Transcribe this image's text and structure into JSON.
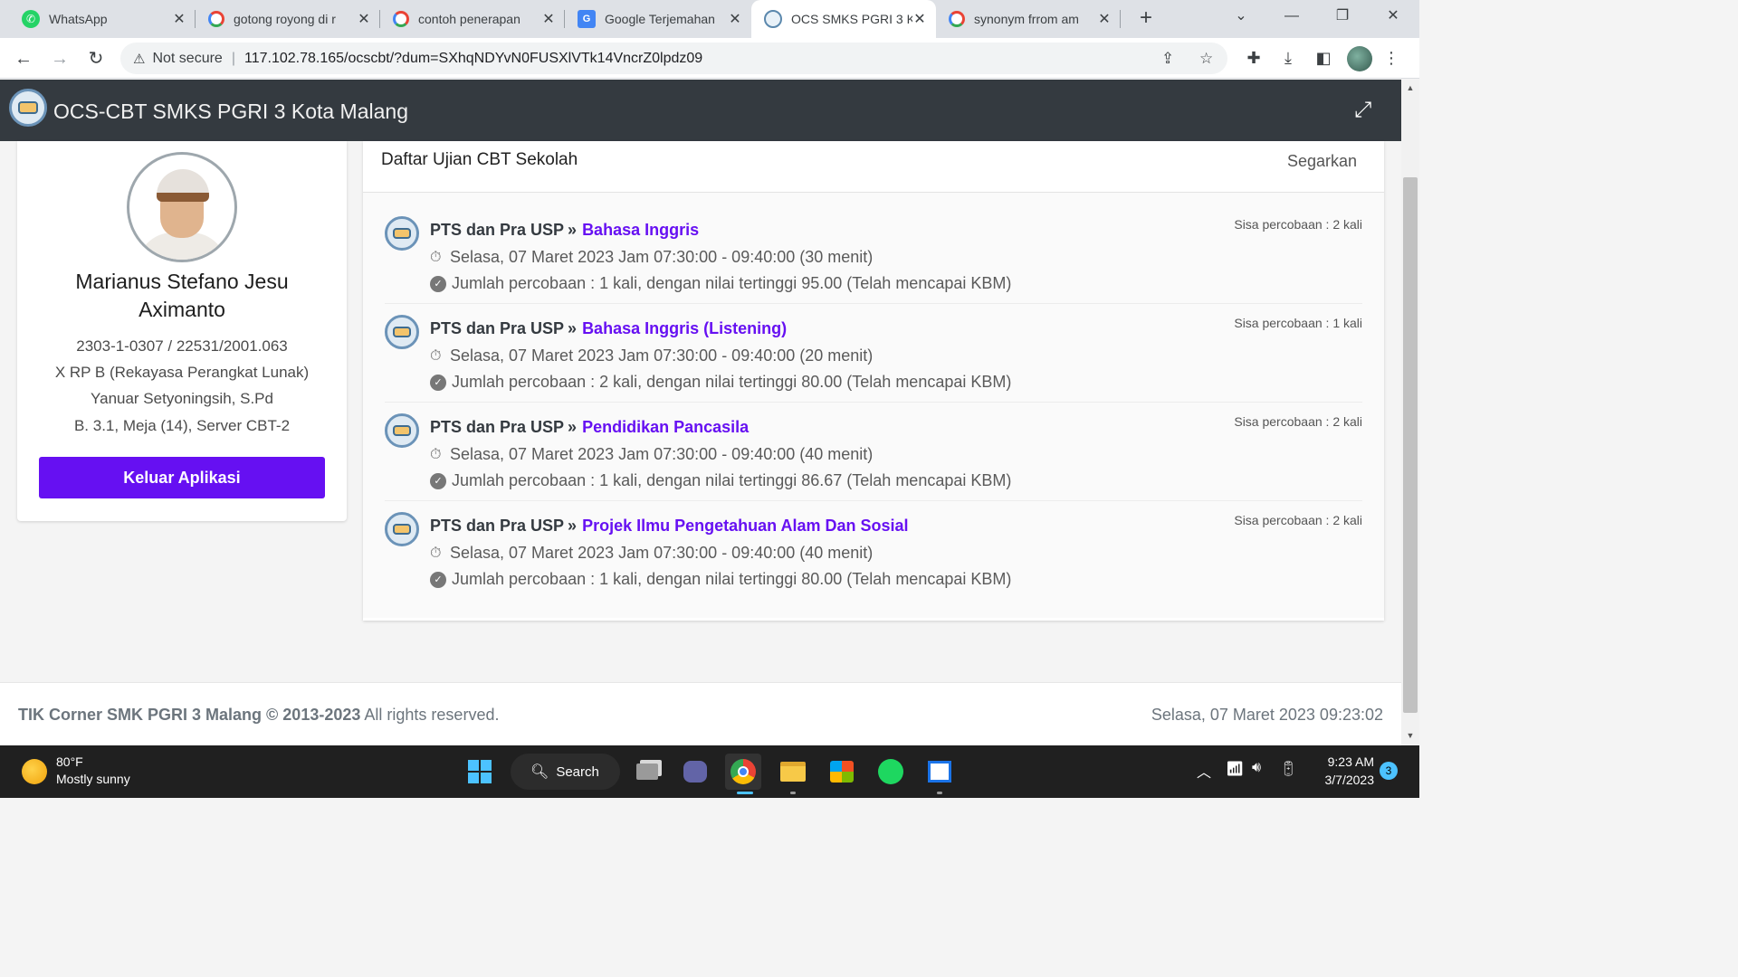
{
  "browser": {
    "tabs": [
      {
        "label": "WhatsApp",
        "favicon": "whatsapp-icon",
        "active": false
      },
      {
        "label": "gotong royong di r",
        "favicon": "google-icon",
        "active": false
      },
      {
        "label": "contoh penerapan",
        "favicon": "google-icon",
        "active": false
      },
      {
        "label": "Google Terjemahan",
        "favicon": "google-translate-icon",
        "active": false
      },
      {
        "label": "OCS SMKS PGRI 3 K",
        "favicon": "ocs-logo-icon",
        "active": true
      },
      {
        "label": "synonym frrom am",
        "favicon": "google-icon",
        "active": false
      }
    ],
    "address": {
      "security_label": "Not secure",
      "url": "117.102.78.165/ocscbt/?dum=SXhqNDYvN0FUSXlVTk14VncrZ0lpdz09"
    }
  },
  "app": {
    "title": "OCS-CBT SMKS PGRI 3 Kota Malang",
    "accent_color": "#6610f2",
    "header_color": "#343a40"
  },
  "student": {
    "name": "Marianus Stefano Jesu Aximanto",
    "id_line": "2303-1-0307 / 22531/2001.063",
    "class_line": "X RP B (Rekayasa Perangkat Lunak)",
    "teacher_line": "Yanuar Setyoningsih, S.Pd",
    "room_line": "B. 3.1, Meja (14), Server CBT-2",
    "logout_label": "Keluar Aplikasi"
  },
  "exam_list": {
    "title": "Daftar Ujian CBT Sekolah",
    "refresh_label": "Segarkan",
    "items": [
      {
        "category": "PTS dan Pra USP",
        "subject": "Bahasa Inggris",
        "schedule": "Selasa, 07 Maret 2023 Jam 07:30:00 - 09:40:00 (30 menit)",
        "attempts": "Jumlah percobaan : 1 kali, dengan nilai tertinggi 95.00 (Telah mencapai KBM)",
        "remaining": "Sisa percobaan : 2 kali"
      },
      {
        "category": "PTS dan Pra USP",
        "subject": "Bahasa Inggris (Listening)",
        "schedule": "Selasa, 07 Maret 2023 Jam 07:30:00 - 09:40:00 (20 menit)",
        "attempts": "Jumlah percobaan : 2 kali, dengan nilai tertinggi 80.00 (Telah mencapai KBM)",
        "remaining": "Sisa percobaan : 1 kali"
      },
      {
        "category": "PTS dan Pra USP",
        "subject": "Pendidikan Pancasila",
        "schedule": "Selasa, 07 Maret 2023 Jam 07:30:00 - 09:40:00 (40 menit)",
        "attempts": "Jumlah percobaan : 1 kali, dengan nilai tertinggi 86.67 (Telah mencapai KBM)",
        "remaining": "Sisa percobaan : 2 kali"
      },
      {
        "category": "PTS dan Pra USP",
        "subject": "Projek Ilmu Pengetahuan Alam Dan Sosial",
        "schedule": "Selasa, 07 Maret 2023 Jam 07:30:00 - 09:40:00 (40 menit)",
        "attempts": "Jumlah percobaan : 1 kali, dengan nilai tertinggi 80.00 (Telah mencapai KBM)",
        "remaining": "Sisa percobaan : 2 kali"
      }
    ]
  },
  "footer": {
    "brand": "TIK Corner SMK PGRI 3 Malang © 2013-2023",
    "rights": "All rights reserved.",
    "datetime": "Selasa, 07 Maret 2023 09:23:02"
  },
  "taskbar": {
    "weather_temp": "80°F",
    "weather_desc": "Mostly sunny",
    "search_label": "Search",
    "clock_time": "9:23 AM",
    "clock_date": "3/7/2023",
    "notification_count": "3"
  }
}
